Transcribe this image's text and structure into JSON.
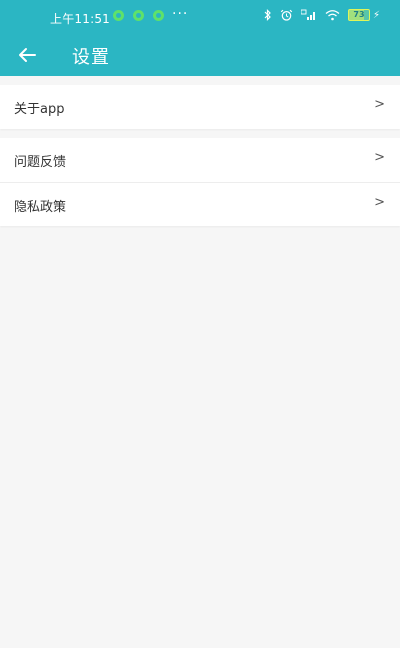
{
  "status_bar": {
    "time": "上午11:51",
    "more": "···",
    "battery_level": "73",
    "charging_glyph": "⚡",
    "icons": [
      "app-notification-icon",
      "app-notification-icon",
      "app-notification-icon",
      "bluetooth-icon",
      "alarm-icon",
      "signal-icon",
      "wifi-icon",
      "battery-icon"
    ]
  },
  "header": {
    "back_icon": "back-arrow-icon",
    "title": "设置",
    "color": "#2bb6c3"
  },
  "settings": {
    "group1": [
      {
        "label": "关于app",
        "chevron": ">"
      }
    ],
    "group2": [
      {
        "label": "问题反馈",
        "chevron": ">"
      },
      {
        "label": "隐私政策",
        "chevron": ">"
      }
    ]
  }
}
